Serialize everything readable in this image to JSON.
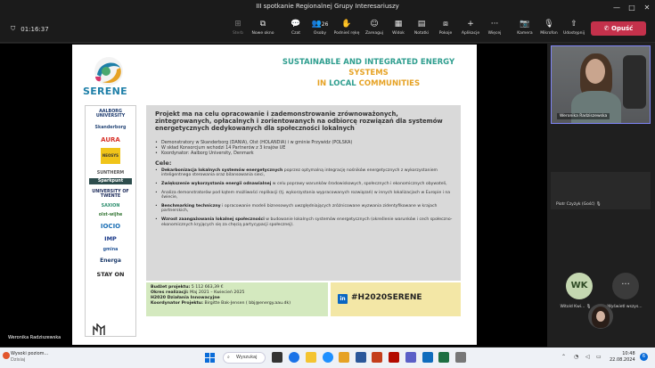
{
  "window": {
    "title": "III spotkanie Regionalnej Grupy Interesariuszy",
    "controls": [
      "—",
      "□",
      "✕"
    ]
  },
  "toolbar": {
    "timer": "01:16:37",
    "buttons": [
      {
        "name": "view-button",
        "label": "Sterb",
        "icon": "⊞"
      },
      {
        "name": "new-view-button",
        "label": "Nowe okno",
        "icon": "⧉"
      },
      {
        "name": "chat-button",
        "label": "Czat",
        "icon": "💬"
      },
      {
        "name": "people-button",
        "label": "Osoby",
        "icon": "👥",
        "count": "26"
      },
      {
        "name": "raise-hand-button",
        "label": "Podnieś rękę",
        "icon": "✋"
      },
      {
        "name": "react-button",
        "label": "Zareaguj",
        "icon": "☺"
      },
      {
        "name": "view-layout-button",
        "label": "Widok",
        "icon": "▦"
      },
      {
        "name": "notes-button",
        "label": "Notatki",
        "icon": "▤"
      },
      {
        "name": "rooms-button",
        "label": "Pokoje",
        "icon": "⧈"
      },
      {
        "name": "apps-button",
        "label": "Aplikacje",
        "icon": "+"
      },
      {
        "name": "more-button",
        "label": "Więcej",
        "icon": "···"
      },
      {
        "name": "camera-button",
        "label": "Kamera",
        "icon": "📷"
      },
      {
        "name": "mic-button",
        "label": "Mikrofon",
        "icon": "🎙"
      },
      {
        "name": "share-button",
        "label": "Udostępnij",
        "icon": "⇧"
      }
    ],
    "leave_label": "Opuść"
  },
  "slide": {
    "logo_text": "SERENE",
    "headline_parts": [
      "SUSTAINABLE",
      " AND ",
      "INTEGRATED ENERGY",
      " SYSTEMS",
      "IN ",
      "LOCAL",
      " COMMUNITIES"
    ],
    "partners": [
      "AALBORG UNIVERSITY",
      "Skanderborg",
      "AURA",
      "NEOSYS",
      "SUNTHERM",
      "Sparkpunt",
      "UNIVERSITY OF TWENTE",
      "SAXION",
      "olst-wijhe",
      "IOCIO",
      "IMP",
      "gmina",
      "Energa",
      "STAY ON"
    ],
    "intro": "Projekt ma na celu opracowanie i zademonstrowanie zrównoważonych, zintegrowanych, opłacalnych i zorientowanych na odbiorcę rozwiązań dla systemów energetycznych dedykowanych dla społeczności lokalnych",
    "bullets": [
      "Demonstratory w Skanderborg (DANIA), Olst (HOLANDIA) i w gminie Przywidz (POLSKA)",
      "W skład Konsorcjum wchodzi 14 Partnerów z 3 krajów UE",
      "Koordynator: Aalborg University, Denmark"
    ],
    "cele_label": "Cele:",
    "goals": [
      {
        "bold": "Dekarbonizacja lokalnych systemów energetycznych",
        "rest": " poprzez optymalną integrację nośników energetycznych z wykorzystaniem inteligentnego sterowania oraz bilansowania sieci,"
      },
      {
        "bold": "Zwiększenie wykorzystania energii odnawialnej",
        "rest": " w celu poprawy warunków środowiskowych, społecznych i ekonomicznych obywateli,"
      },
      {
        "bold": "",
        "rest": "Analiza demonstratorów pod kątem możliwości replikacji (tj. wykorzystania wypracowanych rozwiązań) w innych lokalizacjach w Europie i na świecie,"
      },
      {
        "bold": "Benchmarking techniczny",
        "rest": " i opracowanie modeli biznesowych uwzględniających zróżnicowane wyzwania zidentyfikowane w krajach partnerskich,"
      },
      {
        "bold": "Wzrost zaangażowania lokalnej społeczności",
        "rest": " w budowanie lokalnych systemów energetycznych (określenie warunków i cech społeczno-ekonomicznych kryjących się za chęcią partycypacji społecznej)."
      }
    ],
    "budget": {
      "line1_label": "Budżet projektu:",
      "line1_value": " 5 112 663,39 €",
      "line2_label": "Okres realizacji:",
      "line2_value": " Maj 2021 – Kwiecień 2025",
      "line3": "H2020 Działania Innowacyjne",
      "line4_label": "Koordynator Projektu:",
      "line4_value": " Birgitte Bak-Jensen ( bbj@energy.aau.dk)"
    },
    "hashtag": "#H2020SERENE",
    "linkedin_icon_text": "in",
    "presenter_label": "Weronika Radziszewska"
  },
  "participants": {
    "camera_name": "Weronika Radziszewska",
    "tile_name": "Piotr Czyżyk (Gość)",
    "wk_initials": "WK",
    "wk_name": "Witold Kwi...",
    "more_label": "Wyświetl wszys..."
  },
  "taskbar": {
    "weather_title": "Wysoki poziom...",
    "weather_sub": "Dzisiaj",
    "search_label": "Wyszukaj",
    "time": "10:48",
    "date": "22.08.2024"
  },
  "colors": {
    "accent": "#7f85f5",
    "leave": "#c4314b",
    "serene_teal": "#2f9e8f",
    "serene_orange": "#e6a224"
  }
}
